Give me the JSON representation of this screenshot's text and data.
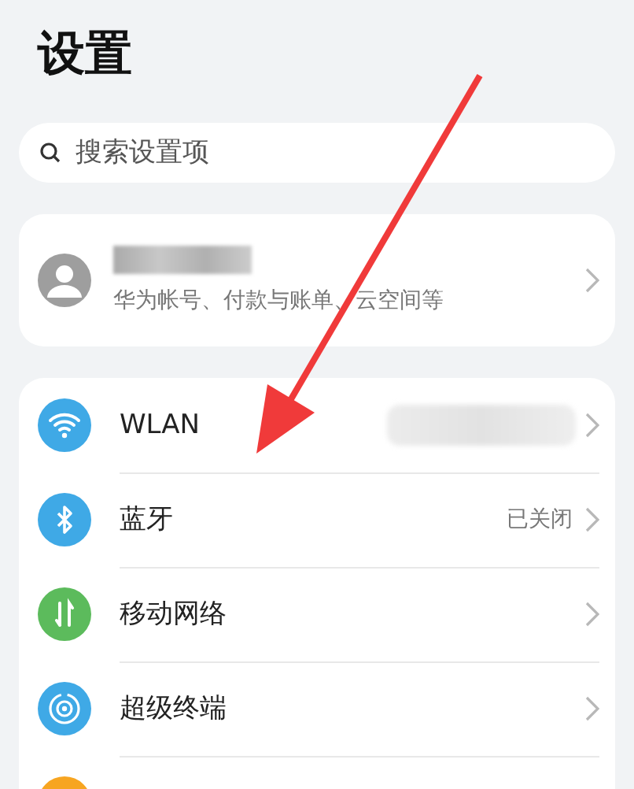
{
  "title": "设置",
  "search": {
    "placeholder": "搜索设置项"
  },
  "account": {
    "subtitle": "华为帐号、付款与账单、云空间等",
    "name_redacted": true
  },
  "settings": [
    {
      "kind": "wifi",
      "label": "WLAN",
      "value_redacted": true
    },
    {
      "kind": "bluetooth",
      "label": "蓝牙",
      "value": "已关闭"
    },
    {
      "kind": "mobile",
      "label": "移动网络"
    },
    {
      "kind": "devices",
      "label": "超级终端"
    },
    {
      "kind": "partial"
    }
  ]
}
